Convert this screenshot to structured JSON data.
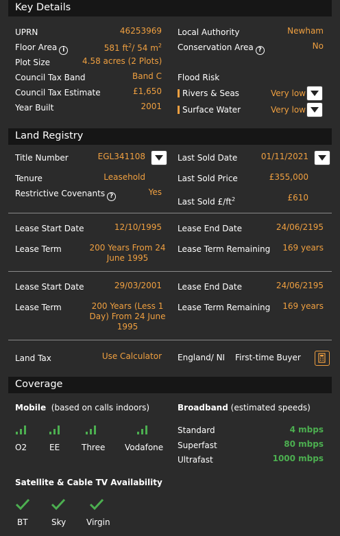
{
  "key_details": {
    "title": "Key Details",
    "uprn_label": "UPRN",
    "uprn": "46253969",
    "floor_area_label": "Floor Area",
    "floor_area_pre": "581 ft",
    "floor_area_sup1": "2",
    "floor_area_mid": "/ 54 m",
    "floor_area_sup2": "2",
    "plot_size_label": "Plot Size",
    "plot_size": "4.58 acres (2 Plots)",
    "council_band_label": "Council Tax Band",
    "council_band": "Band C",
    "council_est_label": "Council Tax Estimate",
    "council_est": "£1,650",
    "year_built_label": "Year Built",
    "year_built": "2001",
    "local_authority_label": "Local Authority",
    "local_authority": "Newham",
    "conservation_label": "Conservation Area",
    "conservation": "No",
    "flood_risk_label": "Flood Risk",
    "rivers_label": "Rivers & Seas",
    "rivers": "Very low",
    "surface_label": "Surface Water",
    "surface": "Very low"
  },
  "land_registry": {
    "title": "Land Registry",
    "title_number_label": "Title Number",
    "title_number": "EGL341108",
    "tenure_label": "Tenure",
    "tenure": "Leasehold",
    "covenants_label": "Restrictive Covenants",
    "covenants": "Yes",
    "last_sold_date_label": "Last Sold Date",
    "last_sold_date": "01/11/2021",
    "last_sold_price_label": "Last Sold Price",
    "last_sold_price": "£355,000",
    "last_sold_sqft_label": "Last Sold £/ft",
    "last_sold_sqft_sup": "2",
    "last_sold_sqft": "£610",
    "leases": [
      {
        "start_label": "Lease Start Date",
        "start": "12/10/1995",
        "end_label": "Lease End Date",
        "end": "24/06/2195",
        "term_label": "Lease Term",
        "term_l1": "200 Years From 24",
        "term_l2": "June 1995",
        "term_l3": "",
        "remaining_label": "Lease Term Remaining",
        "remaining": "169 years"
      },
      {
        "start_label": "Lease Start Date",
        "start": "29/03/2001",
        "end_label": "Lease End Date",
        "end": "24/06/2195",
        "term_label": "Lease Term",
        "term_l1": "200 Years (Less 1",
        "term_l2": "Day) From 24 June",
        "term_l3": "1995",
        "remaining_label": "Lease Term Remaining",
        "remaining": "169 years"
      }
    ],
    "land_tax_label": "Land Tax",
    "land_tax": "Use Calculator",
    "england_ni": "England/ NI",
    "first_time_buyer": "First-time Buyer"
  },
  "coverage": {
    "title": "Coverage",
    "mobile_label": "Mobile",
    "mobile_note": "(based on calls indoors)",
    "networks": [
      "O2",
      "EE",
      "Three",
      "Vodafone"
    ],
    "broadband_label": "Broadband",
    "broadband_note": "(estimated speeds)",
    "broadband": [
      {
        "name": "Standard",
        "speed": "4 mbps"
      },
      {
        "name": "Superfast",
        "speed": "80 mbps"
      },
      {
        "name": "Ultrafast",
        "speed": "1000 mbps"
      }
    ],
    "tv_label": "Satellite & Cable TV Availability",
    "tv": [
      "BT",
      "Sky",
      "Virgin"
    ]
  },
  "colors": {
    "accent": "#f0a040",
    "good": "#4caf50",
    "header_bg": "#161616",
    "bg": "#2b2b2b"
  },
  "icons": [
    "info-icon",
    "chevron-down-icon",
    "signal-icon",
    "check-icon",
    "calculator-icon"
  ]
}
